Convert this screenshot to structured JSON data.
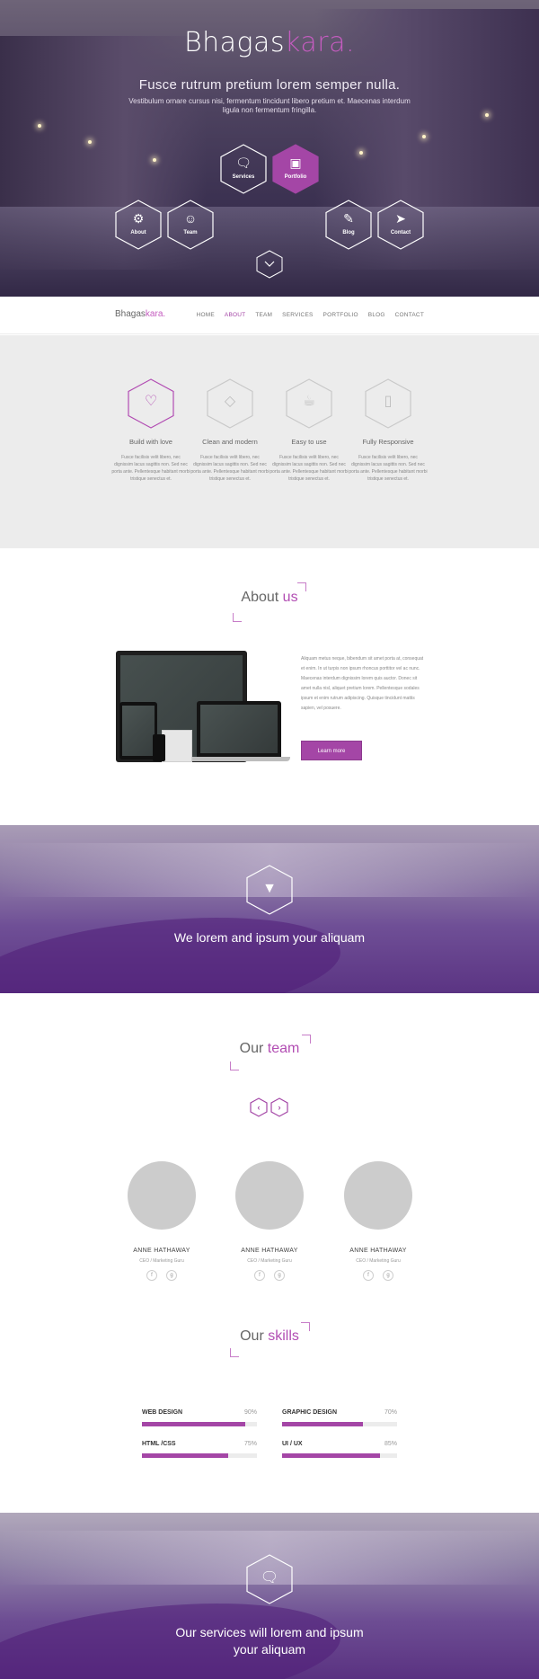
{
  "brand": {
    "name_part1": "Bhagas",
    "name_part2": "kara",
    "dot": "."
  },
  "hero": {
    "title": "Fusce rutrum pretium lorem semper nulla.",
    "subtitle": "Vestibulum ornare cursus nisi, fermentum tincidunt libero pretium et. Maecenas interdum ligula non fermentum fringilla.",
    "buttons": [
      {
        "label": "Services",
        "icon": "chat-bubble-icon"
      },
      {
        "label": "Portfolio",
        "icon": "picture-icon"
      },
      {
        "label": "About",
        "icon": "gear-icon"
      },
      {
        "label": "Team",
        "icon": "user-icon"
      },
      {
        "label": "Blog",
        "icon": "pencil-icon"
      },
      {
        "label": "Contact",
        "icon": "paper-plane-icon"
      }
    ],
    "scroll_icon": "chevron-down-icon"
  },
  "nav": {
    "items": [
      "HOME",
      "ABOUT",
      "TEAM",
      "SERVICES",
      "PORTFOLIO",
      "BLOG",
      "CONTACT"
    ],
    "active": "ABOUT"
  },
  "features": [
    {
      "title": "Build with love",
      "icon": "heart-icon",
      "text": "Fusce facilisis velit libero, nec dignissim lacus sagittis non. Sed nec porta ante. Pellentesque habitant morbi tristique senectus et."
    },
    {
      "title": "Clean and modern",
      "icon": "diamond-icon",
      "text": "Fusce facilisis velit libero, nec dignissim lacus sagittis non. Sed nec porta ante. Pellentesque habitant morbi tristique senectus et."
    },
    {
      "title": "Easy to use",
      "icon": "cup-icon",
      "text": "Fusce facilisis velit libero, nec dignissim lacus sagittis non. Sed nec porta ante. Pellentesque habitant morbi tristique senectus et."
    },
    {
      "title": "Fully Responsive",
      "icon": "tablet-icon",
      "text": "Fusce facilisis velit libero, nec dignissim lacus sagittis non. Sed nec porta ante. Pellentesque habitant morbi tristique senectus et."
    }
  ],
  "about": {
    "heading_part1": "About",
    "heading_part2": "us",
    "text": "Aliquam metus neque, bibendum sit amet porta at, consequat et enim. In ut turpis non ipsum rhoncus porttitor vel ac nunc. Maecenas interdum dignissim lorem quis auctor. Donec sit amet nulla nisl, aliquet pretium lorem. Pellentesque sodales ipsum et enim rutrum adipiscing. Quisque tincidunt mattis sapien, vel posuere.",
    "button": "Learn more"
  },
  "band1": {
    "icon": "graduation-cap-icon",
    "title": "We lorem and ipsum your aliquam"
  },
  "team": {
    "heading_part1": "Our",
    "heading_part2": "team",
    "prev_icon": "chevron-left-icon",
    "next_icon": "chevron-right-icon",
    "members": [
      {
        "name": "ANNE HATHAWAY",
        "role": "CEO / Marketing Guru",
        "social": [
          "f",
          "g"
        ]
      },
      {
        "name": "ANNE HATHAWAY",
        "role": "CEO / Marketing Guru",
        "social": [
          "f",
          "g"
        ]
      },
      {
        "name": "ANNE HATHAWAY",
        "role": "CEO / Marketing Guru",
        "social": [
          "f",
          "g"
        ]
      }
    ]
  },
  "skills": {
    "heading_part1": "Our",
    "heading_part2": "skills",
    "items": [
      {
        "name": "WEB DESIGN",
        "percent_label": "90%",
        "value": 90
      },
      {
        "name": "GRAPHIC DESIGN",
        "percent_label": "70%",
        "value": 70
      },
      {
        "name": "HTML /CSS",
        "percent_label": "75%",
        "value": 75
      },
      {
        "name": "UI / UX",
        "percent_label": "85%",
        "value": 85
      }
    ]
  },
  "band2": {
    "icon": "chat-bubble-icon",
    "title_line1": "Our services will lorem and ipsum",
    "title_line2": "your aliquam"
  },
  "colors": {
    "accent": "#a446a6",
    "accent_light": "#c45cbf",
    "band_purple": "#5b3483",
    "feature_bg": "#ececec"
  }
}
